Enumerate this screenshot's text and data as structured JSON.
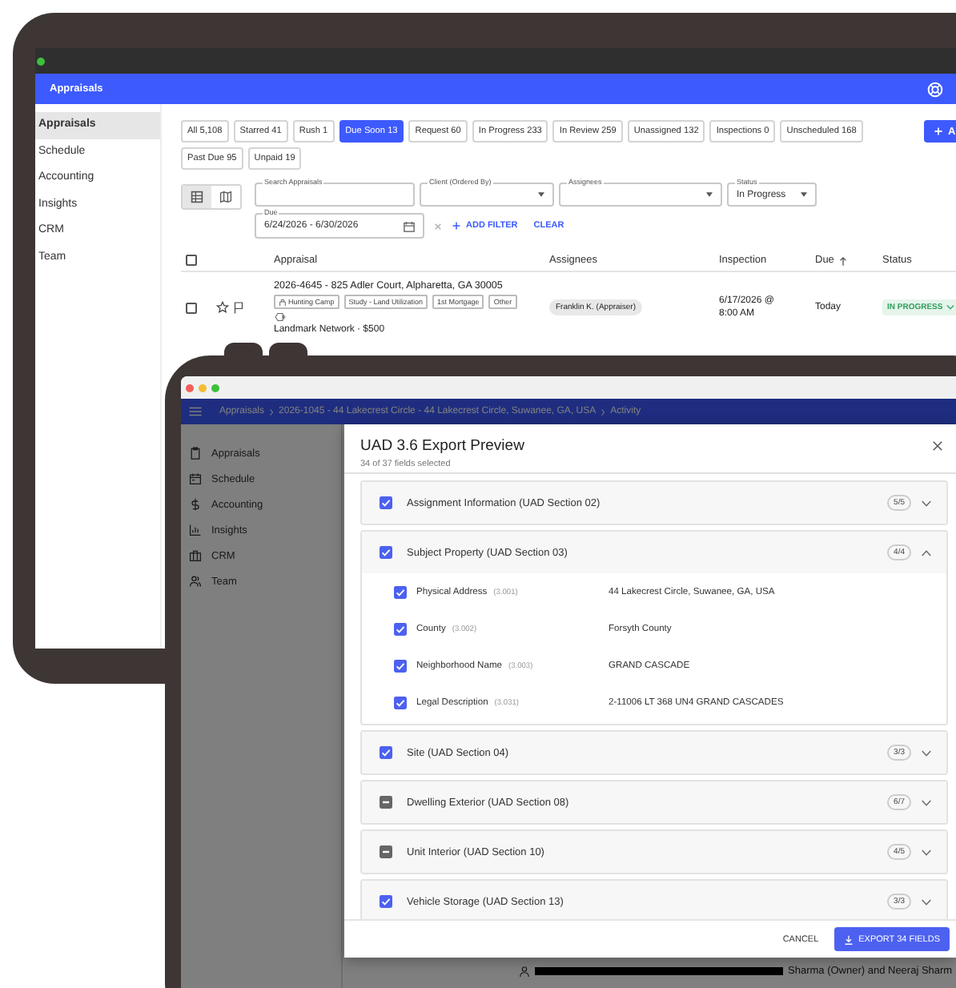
{
  "back_window": {
    "header_title": "Appraisals",
    "sidebar": [
      {
        "label": "Appraisals",
        "selected": true
      },
      {
        "label": "Schedule",
        "selected": false
      },
      {
        "label": "Accounting",
        "selected": false
      },
      {
        "label": "Insights",
        "selected": false
      },
      {
        "label": "CRM",
        "selected": false
      },
      {
        "label": "Team",
        "selected": false
      }
    ],
    "chips": [
      {
        "label": "All 5,108",
        "selected": false
      },
      {
        "label": "Starred 41",
        "selected": false
      },
      {
        "label": "Rush 1",
        "selected": false
      },
      {
        "label": "Due Soon 13",
        "selected": true
      },
      {
        "label": "Request 60",
        "selected": false
      },
      {
        "label": "In Progress 233",
        "selected": false
      },
      {
        "label": "In Review 259",
        "selected": false
      },
      {
        "label": "Unassigned 132",
        "selected": false
      },
      {
        "label": "Inspections 0",
        "selected": false
      },
      {
        "label": "Unscheduled 168",
        "selected": false
      },
      {
        "label": "Past Due 95",
        "selected": false
      },
      {
        "label": "Unpaid 19",
        "selected": false
      }
    ],
    "add_button": "A",
    "view_modes": [
      {
        "kind": "table",
        "selected": true
      },
      {
        "kind": "map",
        "selected": false
      }
    ],
    "filters": [
      {
        "label": "Search Appraisals",
        "kind": "text"
      },
      {
        "label": "Client (Ordered By)",
        "kind": "select"
      },
      {
        "label": "Assignees",
        "kind": "select"
      },
      {
        "label": "Status",
        "kind": "select",
        "value": "In Progress"
      },
      {
        "label": "Due",
        "kind": "date",
        "value": "6/24/2026 - 6/30/2026"
      }
    ],
    "add_filter": "ADD FILTER",
    "clear": "CLEAR",
    "table": {
      "select_all_checked": false,
      "columns": [
        {
          "label": "Appraisal",
          "sorted": false
        },
        {
          "label": "Assignees",
          "sorted": false
        },
        {
          "label": "Inspection",
          "sorted": false
        },
        {
          "label": "Due",
          "sorted": true
        },
        {
          "label": "Status",
          "sorted": false
        }
      ],
      "rows": [
        {
          "checked": false,
          "starred": false,
          "title": "2026-4645 - 825 Adler Court, Alpharetta, GA 30005",
          "tags": [
            {
              "label": "Hunting Camp",
              "kind": "icon"
            },
            {
              "label": "Study - Land Utilization",
              "kind": "plain"
            },
            {
              "label": "1st Mortgage",
              "kind": "plain"
            },
            {
              "label": "Other",
              "kind": "plain"
            }
          ],
          "client": "Landmark Network · $500",
          "assignee": "Franklin K. (Appraiser)",
          "inspection": "6/17/2026 @ 8:00 AM",
          "due": "Today",
          "status": "IN PROGRESS"
        }
      ]
    }
  },
  "front_window": {
    "breadcrumb": [
      "Appraisals",
      "2026-1045 - 44 Lakecrest Circle - 44 Lakecrest Circle, Suwanee, GA, USA",
      "Activity"
    ],
    "sidebar": [
      {
        "label": "Appraisals",
        "kind": "clipboard"
      },
      {
        "label": "Schedule",
        "kind": "calendar"
      },
      {
        "label": "Accounting",
        "kind": "dollar"
      },
      {
        "label": "Insights",
        "kind": "chart"
      },
      {
        "label": "CRM",
        "kind": "briefcase"
      },
      {
        "label": "Team",
        "kind": "people"
      }
    ],
    "modal": {
      "title": "UAD 3.6 Export Preview",
      "subtitle": "34 of 37 fields selected",
      "sections": [
        {
          "title": "Assignment Information (UAD Section 02)",
          "count": "5/5",
          "checked": true,
          "indeterminate": false,
          "expanded": false
        },
        {
          "title": "Subject Property (UAD Section 03)",
          "count": "4/4",
          "checked": true,
          "indeterminate": false,
          "expanded": true,
          "fields": [
            {
              "label": "Physical Address",
              "code": "(3.001)",
              "value": "44 Lakecrest Circle, Suwanee, GA, USA",
              "checked": true
            },
            {
              "label": "County",
              "code": "(3.002)",
              "value": "Forsyth County",
              "checked": true
            },
            {
              "label": "Neighborhood Name",
              "code": "(3.003)",
              "value": "GRAND CASCADE",
              "checked": true
            },
            {
              "label": "Legal Description",
              "code": "(3.031)",
              "value": "2-11006 LT 368 UN4 GRAND CASCADES",
              "checked": true
            }
          ]
        },
        {
          "title": "Site (UAD Section 04)",
          "count": "3/3",
          "checked": true,
          "indeterminate": false,
          "expanded": false
        },
        {
          "title": "Dwelling Exterior (UAD Section 08)",
          "count": "6/7",
          "checked": false,
          "indeterminate": true,
          "expanded": false
        },
        {
          "title": "Unit Interior (UAD Section 10)",
          "count": "4/5",
          "checked": false,
          "indeterminate": true,
          "expanded": false
        },
        {
          "title": "Vehicle Storage (UAD Section 13)",
          "count": "3/3",
          "checked": true,
          "indeterminate": false,
          "expanded": false
        }
      ],
      "cancel": "CANCEL",
      "export": "EXPORT 34 FIELDS"
    },
    "background_text": "Sharma (Owner) and Neeraj Sharm"
  }
}
